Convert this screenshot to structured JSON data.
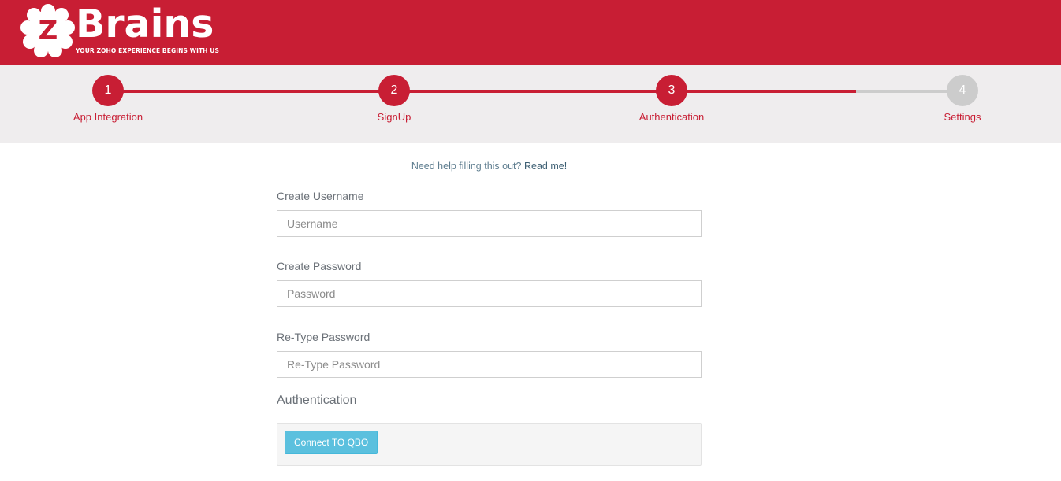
{
  "brand": {
    "logo_letter": "Z",
    "name": "Brains",
    "tagline": "YOUR ZOHO EXPERIENCE BEGINS WITH US",
    "color": "#c81e34"
  },
  "steps": [
    {
      "number": "1",
      "label": "App Integration",
      "active": true
    },
    {
      "number": "2",
      "label": "SignUp",
      "active": true
    },
    {
      "number": "3",
      "label": "Authentication",
      "active": true
    },
    {
      "number": "4",
      "label": "Settings",
      "active": false
    }
  ],
  "progress": {
    "completed_fraction": 0.875,
    "active_color": "#c81e34",
    "inactive_color": "#cccccc"
  },
  "help": {
    "text": "Need help filling this out?",
    "link": "Read me!"
  },
  "form": {
    "username": {
      "label": "Create Username",
      "placeholder": "Username",
      "value": ""
    },
    "password": {
      "label": "Create Password",
      "placeholder": "Password",
      "value": ""
    },
    "retype": {
      "label": "Re-Type Password",
      "placeholder": "Re-Type Password",
      "value": ""
    }
  },
  "authentication": {
    "title": "Authentication",
    "connect_label": "Connect TO QBO",
    "button_color": "#5bc0de"
  }
}
